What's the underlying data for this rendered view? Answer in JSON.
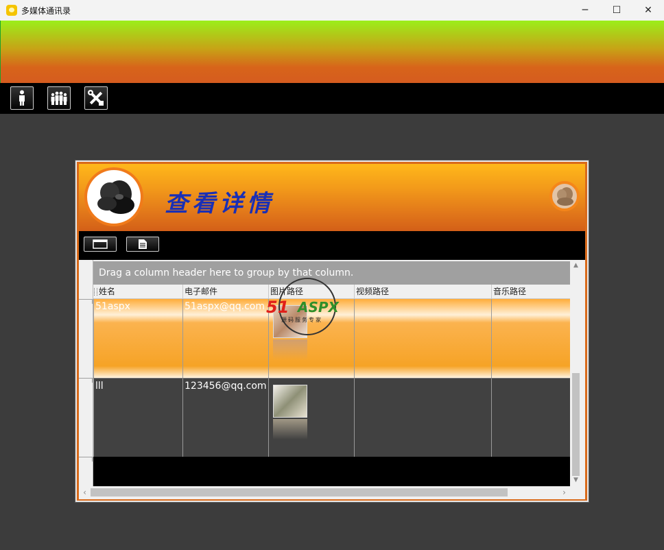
{
  "window": {
    "title": "多媒体通讯录",
    "controls": {
      "minimize": "─",
      "maximize": "☐",
      "close": "✕"
    }
  },
  "main_toolbar": {
    "buttons": [
      {
        "name": "person-icon"
      },
      {
        "name": "group-icon"
      },
      {
        "name": "tools-icon"
      }
    ]
  },
  "detail_panel": {
    "title": "查看详情",
    "toolbar": [
      {
        "name": "window-icon"
      },
      {
        "name": "document-icon"
      }
    ]
  },
  "grid": {
    "group_hint": "Drag a column header here to group by that column.",
    "columns": [
      "姓名",
      "电子邮件",
      "图片路径",
      "视频路径",
      "音乐路径"
    ],
    "rows": [
      {
        "name": "51aspx",
        "email": "51aspx@qq.com",
        "image": "photo-thumbnail",
        "video": "",
        "music": "",
        "selected": true
      },
      {
        "name": "lll",
        "email": "123456@qq.com",
        "image": "photo-thumbnail",
        "video": "",
        "music": "",
        "selected": false
      }
    ]
  },
  "watermark": {
    "brand_a": "51",
    "brand_b": "ASPX",
    "tagline": "源码服务专家"
  },
  "colors": {
    "accent_orange": "#d96a1a",
    "title_blue": "#1a2fb5",
    "selected_row": "#f6a326"
  }
}
